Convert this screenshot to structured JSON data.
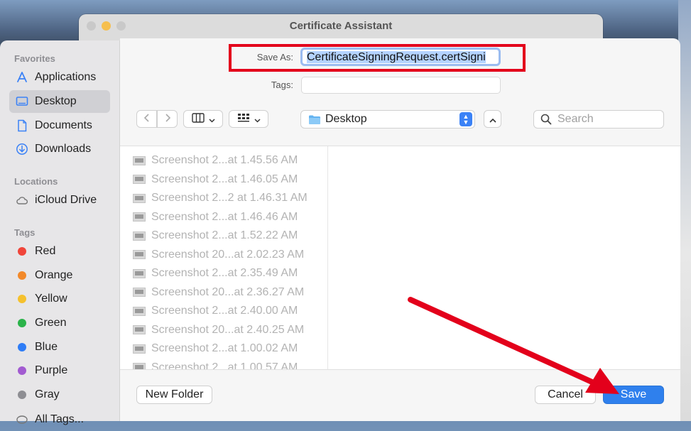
{
  "back_window": {
    "title": "Certificate Assistant"
  },
  "sidebar": {
    "favorites_header": "Favorites",
    "favorites": [
      {
        "label": "Applications",
        "icon": "applications-icon"
      },
      {
        "label": "Desktop",
        "icon": "desktop-icon",
        "selected": true
      },
      {
        "label": "Documents",
        "icon": "document-icon"
      },
      {
        "label": "Downloads",
        "icon": "downloads-icon"
      }
    ],
    "locations_header": "Locations",
    "locations": [
      {
        "label": "iCloud Drive",
        "icon": "cloud-icon"
      }
    ],
    "tags_header": "Tags",
    "tags": [
      {
        "label": "Red",
        "color": "#f0453a"
      },
      {
        "label": "Orange",
        "color": "#f2892a"
      },
      {
        "label": "Yellow",
        "color": "#f5c12e"
      },
      {
        "label": "Green",
        "color": "#2bb34a"
      },
      {
        "label": "Blue",
        "color": "#2f7df6"
      },
      {
        "label": "Purple",
        "color": "#a25bd1"
      },
      {
        "label": "Gray",
        "color": "#8e8e93"
      }
    ],
    "all_tags": "All Tags..."
  },
  "dialog": {
    "save_as_label": "Save As:",
    "save_as_value": "CertificateSigningRequest.certSigni",
    "tags_label": "Tags:",
    "location": "Desktop",
    "search_placeholder": "Search",
    "files": [
      "Screenshot 2...at 1.45.56 AM",
      "Screenshot 2...at 1.46.05 AM",
      "Screenshot 2...2 at 1.46.31 AM",
      "Screenshot 2...at 1.46.46 AM",
      "Screenshot 2...at 1.52.22 AM",
      "Screenshot 20...at 2.02.23 AM",
      "Screenshot 2...at 2.35.49 AM",
      "Screenshot 20...at 2.36.27 AM",
      "Screenshot 2...at 2.40.00 AM",
      "Screenshot 20...at 2.40.25 AM",
      "Screenshot 2...at 1.00.02 AM",
      "Screenshot 2...at 1.00.57 AM"
    ],
    "new_folder_label": "New Folder",
    "cancel_label": "Cancel",
    "save_label": "Save"
  },
  "annotation_color": "#e3001b"
}
